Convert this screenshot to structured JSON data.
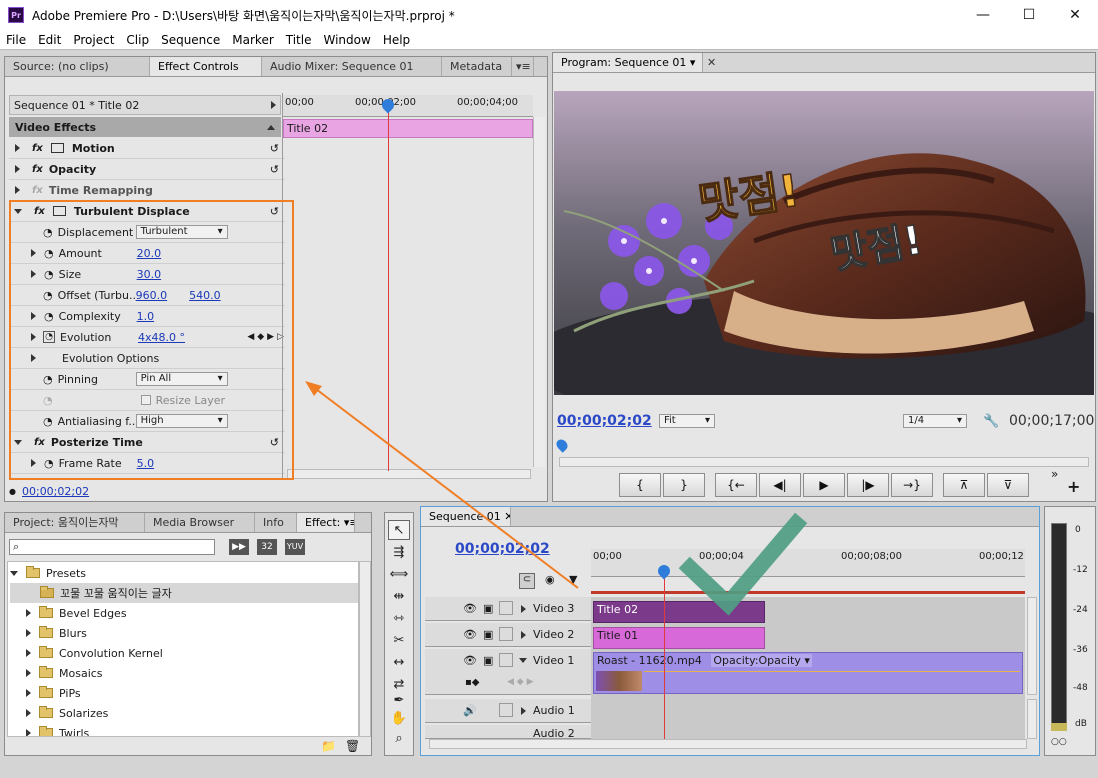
{
  "window": {
    "title": "Adobe Premiere Pro - D:\\Users\\바탕 화면\\움직이는자막\\움직이는자막.prproj *",
    "logo": "Pr"
  },
  "menu": [
    "File",
    "Edit",
    "Project",
    "Clip",
    "Sequence",
    "Marker",
    "Title",
    "Window",
    "Help"
  ],
  "top_left_panel": {
    "tabs": [
      "Source: (no clips)",
      "Effect Controls",
      "Audio Mixer: Sequence 01",
      "Metadata"
    ],
    "active_tab": "Effect Controls",
    "sequence_label": "Sequence 01 * Title 02",
    "ruler": [
      "00;00",
      "00;00;02;00",
      "00;00;04;00"
    ],
    "clip_label": "Title 02",
    "video_effects_header": "Video Effects",
    "effects": [
      {
        "name": "Motion",
        "level": 0
      },
      {
        "name": "Opacity",
        "level": 0
      },
      {
        "name": "Time Remapping",
        "level": 0
      },
      {
        "name": "Turbulent Displace",
        "level": 0
      }
    ],
    "params": [
      {
        "name": "Displacement",
        "value": "Turbulent",
        "kind": "dropdown"
      },
      {
        "name": "Amount",
        "value": "20.0",
        "kind": "num"
      },
      {
        "name": "Size",
        "value": "30.0",
        "kind": "num"
      },
      {
        "name": "Offset (Turbu...",
        "value": "960.0",
        "value2": "540.0",
        "kind": "num2"
      },
      {
        "name": "Complexity",
        "value": "1.0",
        "kind": "num"
      },
      {
        "name": "Evolution",
        "value": "4x48.0 °",
        "kind": "num"
      },
      {
        "name": "Evolution Options",
        "kind": "group"
      },
      {
        "name": "Pinning",
        "value": "Pin All",
        "kind": "dropdown"
      },
      {
        "name": "Resize Layer",
        "kind": "checkbox"
      },
      {
        "name": "Antialiasing f...",
        "value": "High",
        "kind": "dropdown"
      }
    ],
    "posterize": {
      "name": "Posterize Time",
      "param": "Frame Rate",
      "value": "5.0"
    },
    "current_time": "00;00;02;02"
  },
  "program_monitor": {
    "tab": "Program: Sequence 01",
    "timecode_left": "00;00;02;02",
    "fit_option": "Fit",
    "resolution": "1/4",
    "timecode_right": "00;00;17;00",
    "overlay_text_1": "맛점!",
    "overlay_text_2": "맛점!"
  },
  "project_panel": {
    "tabs": [
      "Project: 움직이는자막",
      "Media Browser",
      "Info",
      "Effect:"
    ],
    "badges": [
      "32",
      "YUV"
    ],
    "tree": [
      {
        "label": "Presets",
        "expanded": true,
        "level": 0
      },
      {
        "label": "꼬물 꼬물 움직이는 글자",
        "expanded": false,
        "level": 1,
        "selected": true
      },
      {
        "label": "Bevel Edges",
        "expanded": false,
        "level": 1
      },
      {
        "label": "Blurs",
        "expanded": false,
        "level": 1
      },
      {
        "label": "Convolution Kernel",
        "expanded": false,
        "level": 1
      },
      {
        "label": "Mosaics",
        "expanded": false,
        "level": 1
      },
      {
        "label": "PiPs",
        "expanded": false,
        "level": 1
      },
      {
        "label": "Solarizes",
        "expanded": false,
        "level": 1
      },
      {
        "label": "Twirls",
        "expanded": false,
        "level": 1
      }
    ]
  },
  "timeline": {
    "tab": "Sequence 01",
    "timecode": "00;00;02;02",
    "ruler": [
      "00;00",
      "00;00;04",
      "00;00;08;00",
      "00;00;12"
    ],
    "tracks": [
      {
        "name": "Video 3",
        "clip": "Title 02"
      },
      {
        "name": "Video 2",
        "clip": "Title 01"
      },
      {
        "name": "Video 1",
        "clip": "Roast - 11620.mp4",
        "clip_fx": "Opacity:Opacity"
      },
      {
        "name": "Audio 1"
      },
      {
        "name": "Audio 2"
      }
    ]
  },
  "audio_meter": {
    "labels": [
      "0",
      "-12",
      "-24",
      "-36",
      "-48",
      "dB"
    ]
  },
  "colors": {
    "accent": "#2b48c7",
    "clip_title02": "#7b3a8a",
    "clip_title01": "#d76ad8",
    "clip_video": "#9f8ee6",
    "annotation": "#f07e25",
    "checkmark": "#4f9e83"
  }
}
